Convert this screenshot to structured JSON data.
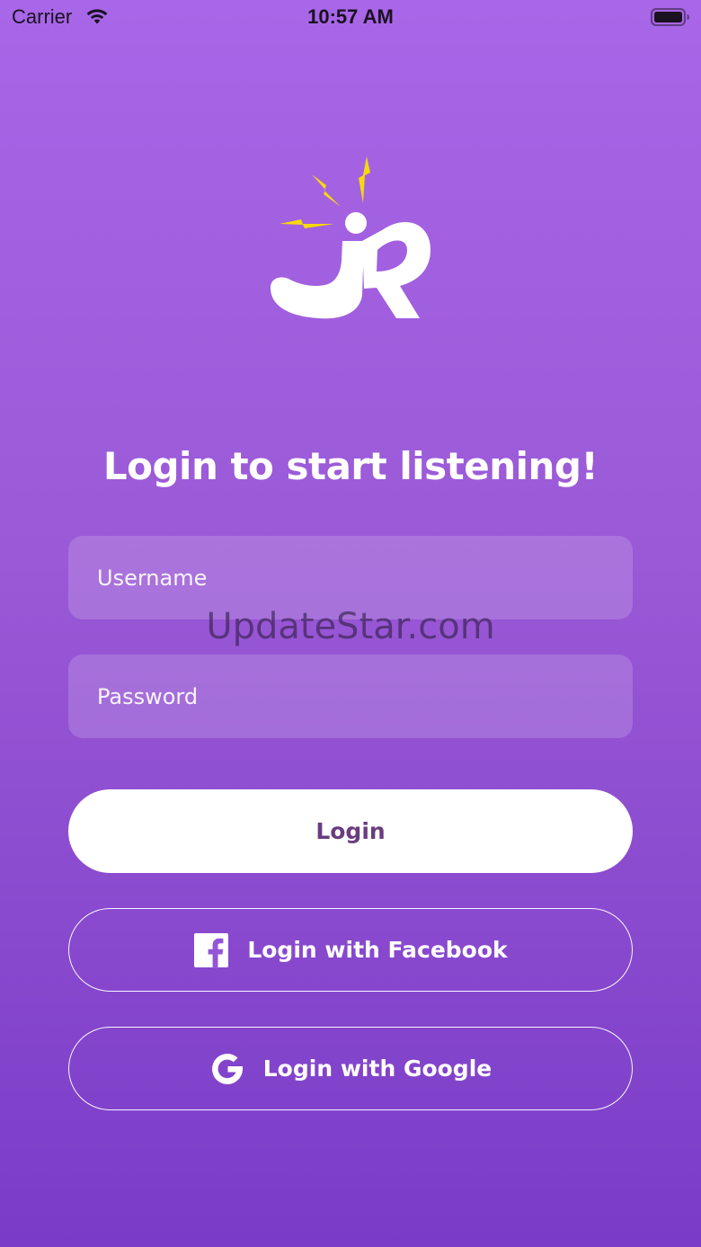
{
  "status_bar": {
    "carrier": "Carrier",
    "time": "10:57 AM"
  },
  "logo": {
    "icon": "jr-logo-icon",
    "bolt_color": "#f5d90a"
  },
  "heading": "Login to start listening!",
  "form": {
    "username_placeholder": "Username",
    "password_placeholder": "Password"
  },
  "buttons": {
    "login": "Login",
    "facebook": "Login with Facebook",
    "google": "Login with Google"
  },
  "watermark": "UpdateStar.com",
  "colors": {
    "gradient_top": "#a866e8",
    "gradient_bottom": "#7a3cc8",
    "login_text": "#6a3c80"
  }
}
